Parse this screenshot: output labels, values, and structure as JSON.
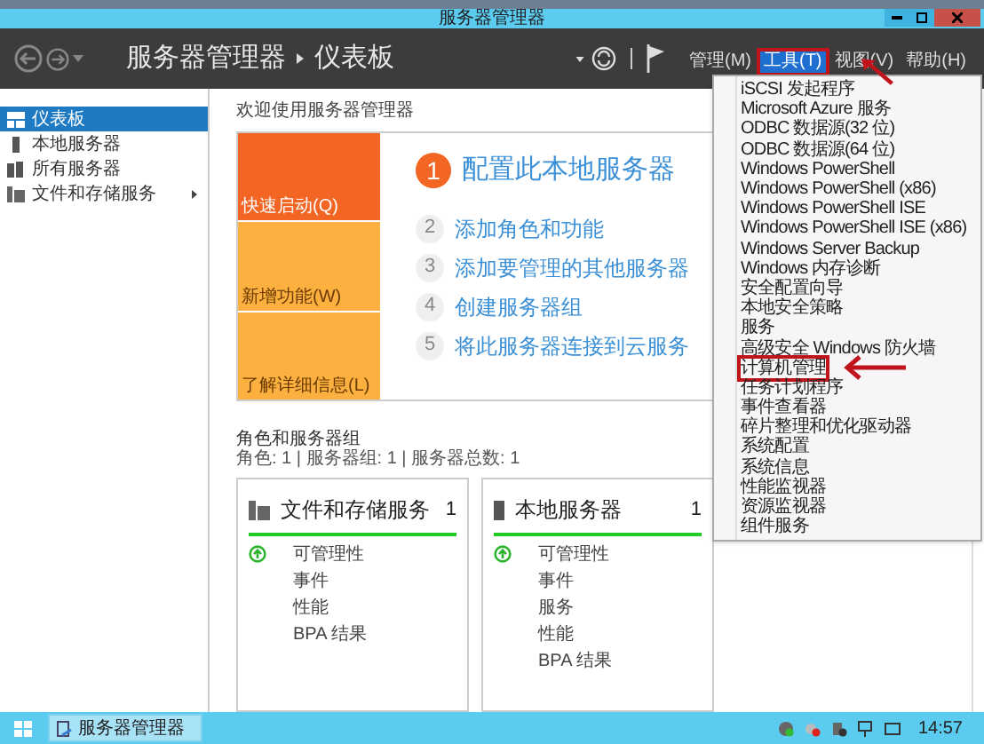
{
  "window": {
    "title": "服务器管理器"
  },
  "header": {
    "breadcrumb": [
      "服务器管理器",
      "仪表板"
    ],
    "menus": [
      {
        "label": "管理(M)",
        "selected": false,
        "marked": false
      },
      {
        "label": "工具(T)",
        "selected": true,
        "marked": true
      },
      {
        "label": "视图(V)",
        "selected": false,
        "marked": false
      },
      {
        "label": "帮助(H)",
        "selected": false,
        "marked": false
      }
    ]
  },
  "tools_menu": {
    "items": [
      {
        "label": "iSCSI 发起程序",
        "marked": false
      },
      {
        "label": "Microsoft Azure 服务",
        "marked": false
      },
      {
        "label": "ODBC 数据源(32 位)",
        "marked": false
      },
      {
        "label": "ODBC 数据源(64 位)",
        "marked": false
      },
      {
        "label": "Windows PowerShell",
        "marked": false
      },
      {
        "label": "Windows PowerShell (x86)",
        "marked": false
      },
      {
        "label": "Windows PowerShell ISE",
        "marked": false
      },
      {
        "label": "Windows PowerShell ISE (x86)",
        "marked": false
      },
      {
        "label": "Windows Server Backup",
        "marked": false
      },
      {
        "label": "Windows 内存诊断",
        "marked": false
      },
      {
        "label": "安全配置向导",
        "marked": false
      },
      {
        "label": "本地安全策略",
        "marked": false
      },
      {
        "label": "服务",
        "marked": false
      },
      {
        "label": "高级安全 Windows 防火墙",
        "marked": false
      },
      {
        "label": "计算机管理",
        "marked": true
      },
      {
        "label": "任务计划程序",
        "marked": false
      },
      {
        "label": "事件查看器",
        "marked": false
      },
      {
        "label": "碎片整理和优化驱动器",
        "marked": false
      },
      {
        "label": "系统配置",
        "marked": false
      },
      {
        "label": "系统信息",
        "marked": false
      },
      {
        "label": "性能监视器",
        "marked": false
      },
      {
        "label": "资源监视器",
        "marked": false
      },
      {
        "label": "组件服务",
        "marked": false
      }
    ]
  },
  "sidebar": {
    "items": [
      {
        "label": "仪表板",
        "selected": true,
        "has_children": false,
        "kind": "dashboard"
      },
      {
        "label": "本地服务器",
        "selected": false,
        "has_children": false,
        "kind": "server"
      },
      {
        "label": "所有服务器",
        "selected": false,
        "has_children": false,
        "kind": "servers"
      },
      {
        "label": "文件和存储服务",
        "selected": false,
        "has_children": true,
        "kind": "storage"
      }
    ]
  },
  "welcome": {
    "title": "欢迎使用服务器管理器",
    "tiles": [
      {
        "label": "快速启动(Q)",
        "kind": "primary"
      },
      {
        "label": "新增功能(W)",
        "kind": "secondary"
      },
      {
        "label": "了解详细信息(L)",
        "kind": "secondary"
      }
    ],
    "steps": [
      {
        "number": "1",
        "label": "配置此本地服务器",
        "kind": "primary"
      },
      {
        "number": "2",
        "label": "添加角色和功能",
        "kind": "secondary"
      },
      {
        "number": "3",
        "label": "添加要管理的其他服务器",
        "kind": "secondary"
      },
      {
        "number": "4",
        "label": "创建服务器组",
        "kind": "secondary"
      },
      {
        "number": "5",
        "label": "将此服务器连接到云服务",
        "kind": "secondary"
      }
    ]
  },
  "roles": {
    "title": "角色和服务器组",
    "summary": "角色: 1 | 服务器组: 1 | 服务器总数: 1",
    "cards": [
      {
        "title": "文件和存储服务",
        "count": "1",
        "kind": "storage",
        "items": [
          {
            "label": "可管理性",
            "ok": true
          },
          {
            "label": "事件",
            "ok": false
          },
          {
            "label": "性能",
            "ok": false
          },
          {
            "label": "BPA 结果",
            "ok": false
          }
        ]
      },
      {
        "title": "本地服务器",
        "count": "1",
        "kind": "server",
        "items": [
          {
            "label": "可管理性",
            "ok": true
          },
          {
            "label": "事件",
            "ok": false
          },
          {
            "label": "服务",
            "ok": false
          },
          {
            "label": "性能",
            "ok": false
          },
          {
            "label": "BPA 结果",
            "ok": false
          }
        ]
      }
    ]
  },
  "taskbar": {
    "app": "服务器管理器",
    "time": "14:57"
  }
}
